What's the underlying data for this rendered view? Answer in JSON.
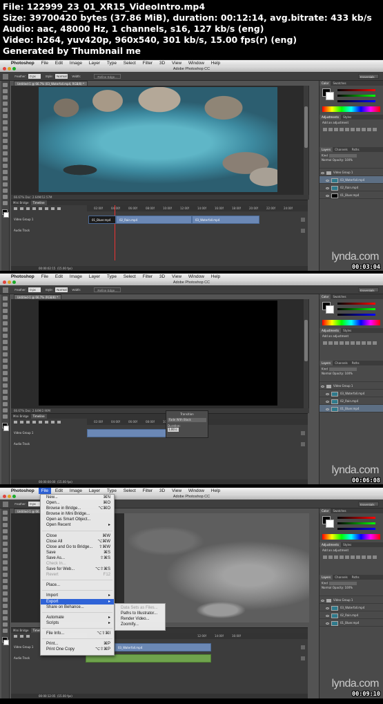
{
  "info": {
    "lines": [
      "File: 122999_23_01_XR15_VideoIntro.mp4",
      "Size: 39700420 bytes (37.86 MiB), duration: 00:12:14, avg.bitrate: 433 kb/s",
      "Audio: aac, 48000 Hz, 1 channels, s16, 127 kb/s (eng)",
      "Video: h264, yuv420p, 960x540, 301 kb/s, 15.00 fps(r) (eng)",
      "Generated by Thumbnail me"
    ]
  },
  "menubar": {
    "app": "Photoshop",
    "items": [
      "File",
      "Edit",
      "Image",
      "Layer",
      "Type",
      "Select",
      "Filter",
      "3D",
      "View",
      "Window",
      "Help"
    ]
  },
  "window_title": "Adobe Photoshop CC",
  "options": {
    "feather_label": "Feather:",
    "feather_value": "0 px",
    "style_label": "Style:",
    "style_value": "Normal",
    "width_label": "Width:",
    "refine": "Refine Edge...",
    "workspace": "Essentials"
  },
  "frames": [
    {
      "doc_tab": "Untitled-1 @ 66.7% (03_Waterfall.mp4, RGB/8) *",
      "doc_status": "66.67%     Doc: 2.64M/12.57M",
      "timecode": "00:00:02:15",
      "fps": "(15.00 fps)",
      "ruler": [
        "02:00f",
        "04:00f",
        "06:00f",
        "08:00f",
        "10:00f",
        "12:00f",
        "14:00f",
        "16:00f",
        "18:00f",
        "20:00f",
        "22:00f",
        "24:00f"
      ],
      "clips": [
        "01_Bluer.mp4",
        "02_Rain.mp4",
        "03_Waterfall.mp4"
      ],
      "stamp": "00:03:04"
    },
    {
      "doc_tab": "Untitled-1 @ 66.7% (RGB/8) *",
      "doc_status": "66.67%     Doc: 2.64M/2.90M",
      "timecode": "00:00:00:00",
      "fps": "(15.00 fps)",
      "transition": {
        "title": "Transition",
        "type": "Fade With Black",
        "duration_label": "Duration:",
        "duration": "1.00 s"
      },
      "stamp": "00:06:08"
    },
    {
      "doc_tab": "Untitled-1 @ 66.7%",
      "timecode": "00:00:12:05",
      "fps": "(15.00 fps)",
      "clips": [
        "03_Waterfall.mp4"
      ],
      "stamp": "00:09:10"
    }
  ],
  "timeline": {
    "tab_bridge": "Mini Bridge",
    "tab_timeline": "Timeline",
    "video_group": "Video Group 1",
    "audio_track": "Audio Track"
  },
  "panels": {
    "color_tab": "Color",
    "swatches_tab": "Swatches",
    "adjust_tab": "Adjustments",
    "styles_tab": "Styles",
    "adjust_hint": "Add an adjustment",
    "layers_tab": "Layers",
    "channels_tab": "Channels",
    "paths_tab": "Paths",
    "kind": "Kind",
    "blend": "Normal",
    "opacity": "Opacity: 100%",
    "layers": [
      "Video Group 1",
      "03_Waterfall.mp4",
      "02_Rain.mp4",
      "01_Bluer.mp4"
    ]
  },
  "filemenu": {
    "items": [
      {
        "label": "New...",
        "sc": "⌘N"
      },
      {
        "label": "Open...",
        "sc": "⌘O"
      },
      {
        "label": "Browse in Bridge...",
        "sc": "⌥⌘O"
      },
      {
        "label": "Browse in Mini Bridge...",
        "sc": ""
      },
      {
        "label": "Open as Smart Object...",
        "sc": ""
      },
      {
        "label": "Open Recent",
        "sc": "▸"
      },
      {
        "label": "Close",
        "sc": "⌘W"
      },
      {
        "label": "Close All",
        "sc": "⌥⌘W"
      },
      {
        "label": "Close and Go to Bridge...",
        "sc": "⇧⌘W"
      },
      {
        "label": "Save",
        "sc": "⌘S"
      },
      {
        "label": "Save As...",
        "sc": "⇧⌘S"
      },
      {
        "label": "Check In...",
        "sc": ""
      },
      {
        "label": "Save for Web...",
        "sc": "⌥⇧⌘S"
      },
      {
        "label": "Revert",
        "sc": "F12"
      },
      {
        "label": "Place...",
        "sc": ""
      },
      {
        "label": "Import",
        "sc": "▸"
      },
      {
        "label": "Export",
        "sc": "▸"
      },
      {
        "label": "Share on Behance...",
        "sc": ""
      },
      {
        "label": "Automate",
        "sc": "▸"
      },
      {
        "label": "Scripts",
        "sc": "▸"
      },
      {
        "label": "File Info...",
        "sc": "⌥⇧⌘I"
      },
      {
        "label": "Print...",
        "sc": "⌘P"
      },
      {
        "label": "Print One Copy",
        "sc": "⌥⇧⌘P"
      }
    ],
    "export_sub": [
      "Data Sets as Files...",
      "Paths to Illustrator...",
      "Render Video...",
      "Zoomify..."
    ]
  },
  "watermark": "lynda.com"
}
